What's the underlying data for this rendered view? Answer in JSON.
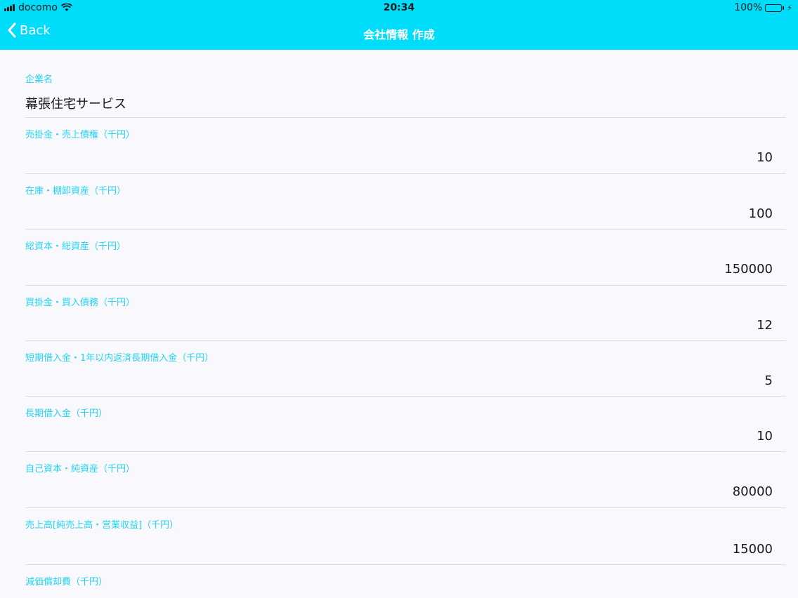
{
  "status_bar": {
    "carrier": "docomo",
    "time": "20:34",
    "battery": "100%"
  },
  "nav": {
    "back_label": "Back",
    "title": "会社情報 作成"
  },
  "fields": [
    {
      "label": "企業名",
      "value": "幕張住宅サービス"
    },
    {
      "label": "売掛金・売上債権（千円）",
      "value": "10"
    },
    {
      "label": "在庫・棚卸資産（千円）",
      "value": "100"
    },
    {
      "label": "総資本・総資産（千円）",
      "value": "150000"
    },
    {
      "label": "買掛金・買入債務（千円）",
      "value": "12"
    },
    {
      "label": "短期借入金・1年以内返済長期借入金（千円）",
      "value": "5"
    },
    {
      "label": "長期借入金（千円）",
      "value": "10"
    },
    {
      "label": "自己資本・純資産（千円）",
      "value": "80000"
    },
    {
      "label": "売上高[純売上高・営業収益]（千円）",
      "value": "15000"
    },
    {
      "label": "減価償却費（千円）",
      "value": ""
    }
  ],
  "colors": {
    "accent": "#00ddfb",
    "label": "#24d3f0",
    "background": "#f9f8fd"
  }
}
